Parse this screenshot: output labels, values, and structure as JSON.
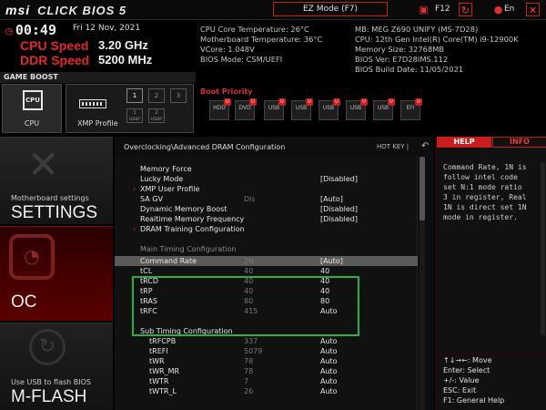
{
  "header": {
    "brand": "msi",
    "product": "CLICK BIOS 5",
    "ez_mode": "EZ Mode (F7)",
    "f12": "F12",
    "lang": "En"
  },
  "status": {
    "clock": "00:49",
    "date": "Fri  12 Nov, 2021",
    "cpu_speed_label": "CPU Speed",
    "cpu_speed_value": "3.20 GHz",
    "ddr_speed_label": "DDR Speed",
    "ddr_speed_value": "5200 MHz"
  },
  "sysinfo": {
    "left": [
      "CPU Core Temperature: 26°C",
      "Motherboard Temperature: 36°C",
      "VCore: 1.048V",
      "BIOS Mode: CSM/UEFI"
    ],
    "right": [
      "MB: MEG Z690 UNIFY (MS-7D28)",
      "CPU: 12th Gen Intel(R) Core(TM) i9-12900K",
      "Memory Size: 32768MB",
      "BIOS Ver: E7D28IMS.112",
      "BIOS Build Date: 11/05/2021"
    ]
  },
  "game_boost": {
    "label": "GAME BOOST",
    "cpu_chip": "CPU",
    "cpu_label": "CPU",
    "xmp_label": "XMP Profile",
    "slots": [
      "1",
      "2",
      "3"
    ],
    "user_slots": [
      "1\nuser",
      "2\nuser"
    ]
  },
  "boot": {
    "label": "Boot Priority",
    "devices": [
      "HDD",
      "DVD",
      "USB",
      "USB",
      "USB",
      "USB",
      "USB",
      "EFI"
    ]
  },
  "nav": {
    "settings_sub": "Motherboard settings",
    "settings_main": "SETTINGS",
    "oc_main": "OC",
    "mflash_sub": "Use USB to flash BIOS",
    "mflash_main": "M-FLASH"
  },
  "main": {
    "breadcrumb": "Overclocking\\Advanced DRAM Configuration",
    "hotkey": "HOT KEY  |  ",
    "rows": [
      {
        "label": "Memory Force",
        "mid": "",
        "val": ""
      },
      {
        "label": "Lucky Mode",
        "mid": "",
        "val": "[Disabled]"
      },
      {
        "label": "XMP User Profile",
        "mid": "",
        "val": ""
      },
      {
        "label": "SA GV",
        "mid": "Dis",
        "val": "[Auto]"
      },
      {
        "label": "Dynamic Memory Boost",
        "mid": "",
        "val": "[Disabled]"
      },
      {
        "label": "Realtime Memory Frequency",
        "mid": "",
        "val": "[Disabled]"
      },
      {
        "label": "DRAM Training Configuration",
        "mid": "",
        "val": ""
      },
      {
        "label": "",
        "mid": "",
        "val": ""
      },
      {
        "label": "Main Timing Configuration",
        "mid": "",
        "val": ""
      },
      {
        "label": "Command Rate",
        "mid": "2N",
        "val": "[Auto]"
      },
      {
        "label": "tCL",
        "mid": "40",
        "val": "40"
      },
      {
        "label": "tRCD",
        "mid": "40",
        "val": "40"
      },
      {
        "label": "tRP",
        "mid": "40",
        "val": "40"
      },
      {
        "label": "tRAS",
        "mid": "80",
        "val": "80"
      },
      {
        "label": "tRFC",
        "mid": "415",
        "val": "Auto"
      },
      {
        "label": "",
        "mid": "",
        "val": ""
      },
      {
        "label": "Sub Timing Configuration",
        "mid": "",
        "val": ""
      },
      {
        "label": "tRFCPB",
        "mid": "337",
        "val": "Auto"
      },
      {
        "label": "tREFI",
        "mid": "5079",
        "val": "Auto"
      },
      {
        "label": "tWR",
        "mid": "78",
        "val": "Auto"
      },
      {
        "label": "tWR_MR",
        "mid": "78",
        "val": "Auto"
      },
      {
        "label": "tWTR",
        "mid": "7",
        "val": "Auto"
      },
      {
        "label": "tWTR_L",
        "mid": "26",
        "val": "Auto"
      }
    ]
  },
  "help": {
    "tab_help": "HELP",
    "tab_info": "INFO",
    "text": "Command Rate, 1N is\nfollow intel code\nset N:1 mode ratio\n3 in register, Real\n1N is direct set 1N\nmode in register.",
    "keys": "↑↓→←: Move\nEnter: Select\n+/-: Value\nESC: Exit\nF1: General Help"
  }
}
